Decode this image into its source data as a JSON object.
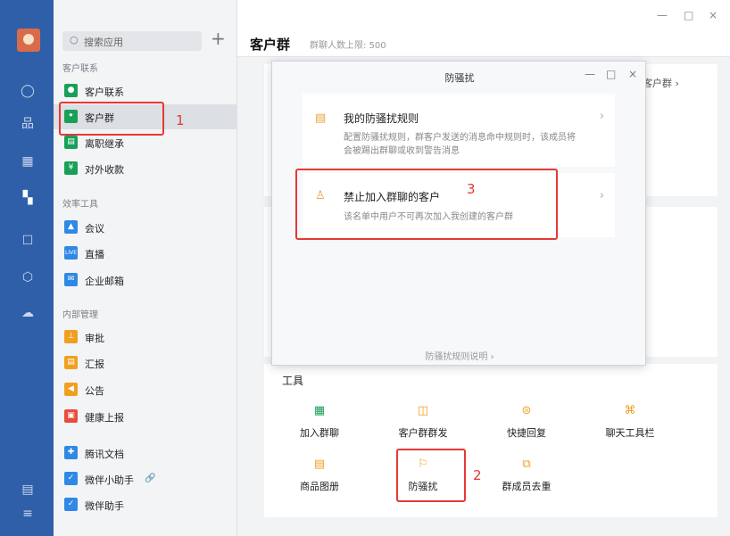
{
  "window": {
    "minimize": "—",
    "maximize": "□",
    "close": "×"
  },
  "sidebar": {
    "search_placeholder": "搜索应用",
    "add": "+",
    "sections": {
      "contacts": "客户联系",
      "efficiency": "效率工具",
      "internal": "内部管理"
    },
    "items": [
      {
        "label": "客户联系",
        "icon": "chat-bubble-icon",
        "color": "#18a058"
      },
      {
        "label": "客户群",
        "icon": "group-icon",
        "color": "#18a058"
      },
      {
        "label": "离职继承",
        "icon": "document-icon",
        "color": "#18a058"
      },
      {
        "label": "对外收款",
        "icon": "payment-icon",
        "color": "#18a058"
      },
      {
        "label": "会议",
        "icon": "meeting-icon",
        "color": "#2f88e5"
      },
      {
        "label": "直播",
        "icon": "live-icon",
        "color": "#2f88e5",
        "icon_text": "LIVE"
      },
      {
        "label": "企业邮箱",
        "icon": "mail-icon",
        "color": "#2f88e5"
      },
      {
        "label": "审批",
        "icon": "approval-icon",
        "color": "#f0a020"
      },
      {
        "label": "汇报",
        "icon": "report-icon",
        "color": "#f0a020"
      },
      {
        "label": "公告",
        "icon": "announcement-icon",
        "color": "#f0a020"
      },
      {
        "label": "健康上报",
        "icon": "health-icon",
        "color": "#e84c3d"
      },
      {
        "label": "腾讯文档",
        "icon": "tencent-docs-icon",
        "color": "#2f88e5"
      },
      {
        "label": "微伴小助手",
        "icon": "checkbox-icon",
        "color": "#2f88e5",
        "sub": "🔗"
      },
      {
        "label": "微伴助手",
        "icon": "checkbox-icon",
        "color": "#2f88e5"
      }
    ]
  },
  "header": {
    "title": "客户群",
    "subtitle": "群聊人数上限: 500"
  },
  "main": {
    "right_peek": "客户群 ›",
    "tools_title": "工具"
  },
  "tools": [
    {
      "label": "加入群聊",
      "icon": "qrcode-icon",
      "color": "#18a058"
    },
    {
      "label": "客户群群发",
      "icon": "broadcast-icon",
      "color": "#f0a020"
    },
    {
      "label": "快捷回复",
      "icon": "quick-reply-icon",
      "color": "#f0a020"
    },
    {
      "label": "聊天工具栏",
      "icon": "toolbar-icon",
      "color": "#f0a020"
    },
    {
      "label": "商品图册",
      "icon": "catalog-icon",
      "color": "#f0a020"
    },
    {
      "label": "防骚扰",
      "icon": "anti-harass-icon",
      "color": "#f0a020"
    },
    {
      "label": "群成员去重",
      "icon": "dedupe-icon",
      "color": "#f0a020"
    }
  ],
  "dialog": {
    "title": "防骚扰",
    "rules": [
      {
        "title": "我的防骚扰规则",
        "desc": "配置防骚扰规则，群客户发送的消息命中规则时，该成员将会被踢出群聊或收到警告消息",
        "icon": "rule-doc-icon"
      },
      {
        "title": "禁止加入群聊的客户",
        "desc": "该名单中用户不可再次加入我创建的客户群",
        "icon": "block-user-icon"
      }
    ],
    "footer": "防骚扰规则说明 ›"
  },
  "annotations": [
    "1",
    "2",
    "3"
  ],
  "colors": {
    "accent_red": "#e53935",
    "rail_blue": "#2f5fa8"
  }
}
